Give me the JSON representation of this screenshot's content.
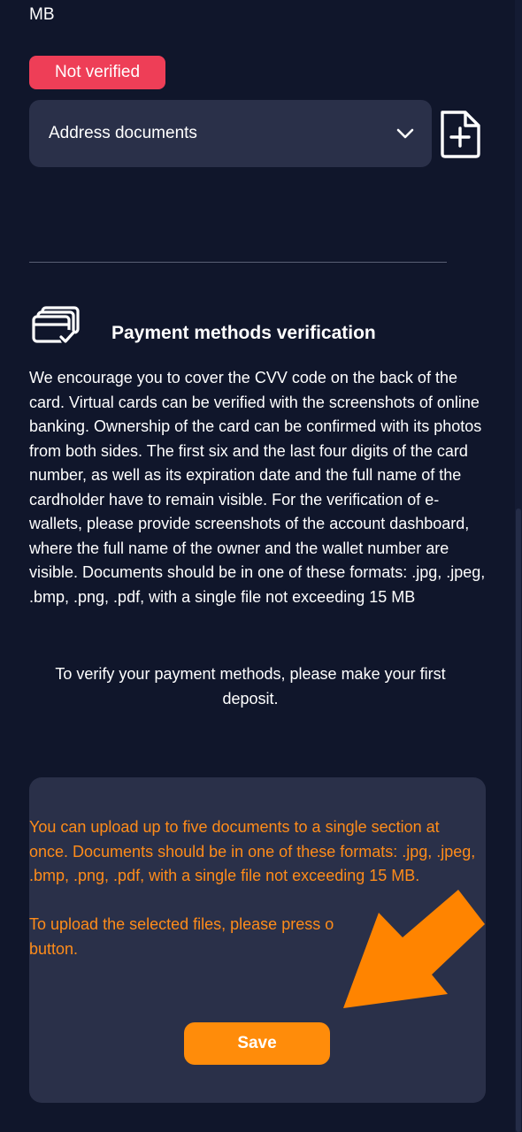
{
  "top": {
    "partial_text": "MB"
  },
  "address": {
    "status_badge": "Not verified",
    "dropdown_label": "Address documents",
    "chevron_icon": "chevron-down-icon",
    "add_file_icon": "file-plus-icon"
  },
  "payment": {
    "icon": "credit-cards-check-icon",
    "title": "Payment methods verification",
    "description": "We encourage you to cover the CVV code on the back of the card. Virtual cards can be verified with the screenshots of online banking. Ownership of the card can be confirmed with its photos from both sides. The first six and the last four digits of the card number, as well as its expiration date and the full name of the cardholder have to remain visible. For the verification of e-wallets, please provide screenshots of the account dashboard, where the full name of the owner and the wallet number are visible. Documents should be in one of these formats: .jpg, .jpeg, .bmp, .png, .pdf, with a single file not exceeding 15 MB",
    "deposit_note": "To verify your payment methods, please make your first deposit."
  },
  "upload_panel": {
    "info_line1": "You can upload up to five documents to a single section at once. Documents should be in one of these formats: .jpg, .jpeg, .bmp, .png, .pdf, with a single file not exceeding 15 MB.",
    "info_line2": "To upload the selected files, please press o",
    "info_line3": "button.",
    "save_label": "Save"
  },
  "colors": {
    "background": "#10162b",
    "panel": "#2a3049",
    "badge": "#ee3e57",
    "accent_orange": "#ff8c0a"
  }
}
